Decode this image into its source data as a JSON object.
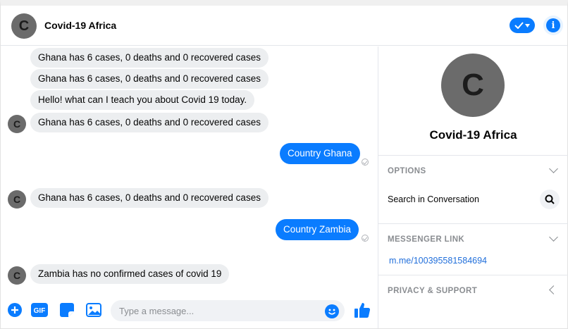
{
  "header": {
    "avatar_letter": "C",
    "title": "Covid-19 Africa"
  },
  "messages": [
    {
      "side": "in",
      "text": "Ghana has 6 cases, 0 deaths and 0 recovered cases"
    },
    {
      "side": "in",
      "text": "Ghana has 6 cases, 0 deaths and 0 recovered cases"
    },
    {
      "side": "in",
      "text": "Hello! what can I teach you about Covid 19 today."
    },
    {
      "side": "in",
      "text": "Ghana has 6 cases, 0 deaths and 0 recovered cases",
      "avatar": "C"
    },
    {
      "side": "out",
      "text": "Country Ghana"
    },
    {
      "side": "in",
      "text": "Ghana has 6 cases, 0 deaths and 0 recovered cases",
      "avatar": "C"
    },
    {
      "side": "out",
      "text": "Country Zambia"
    },
    {
      "side": "in",
      "text": "Zambia has no confirmed cases of covid 19",
      "avatar": "C"
    }
  ],
  "composer": {
    "placeholder": "Type a message...",
    "gif_label": "GIF"
  },
  "sidebar": {
    "avatar_letter": "C",
    "name": "Covid-19 Africa",
    "options_title": "OPTIONS",
    "search_label": "Search in Conversation",
    "messenger_link_title": "MESSENGER LINK",
    "messenger_link": "m.me/100395581584694",
    "privacy_title": "PRIVACY & SUPPORT"
  },
  "colors": {
    "accent": "#0a7cff",
    "bubble_in": "#eceef0",
    "avatar": "#6b6b6b",
    "link": "#216fdb"
  }
}
